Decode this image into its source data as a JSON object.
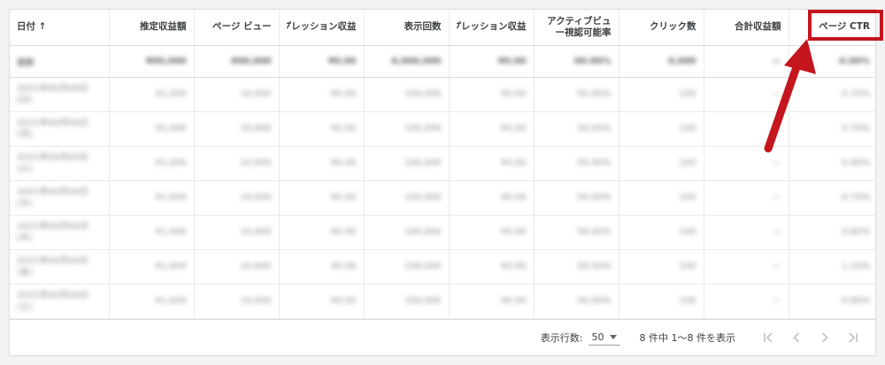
{
  "table": {
    "headers": [
      {
        "label": "日付 ↑",
        "key": "date"
      },
      {
        "label": "推定収益額",
        "key": "est_revenue"
      },
      {
        "label": "ページ ビュー",
        "key": "page_views"
      },
      {
        "label": "ンプレッション収益",
        "key": "impression_rev_1"
      },
      {
        "label": "表示回数",
        "key": "impressions"
      },
      {
        "label": "ンプレッション収益",
        "key": "impression_rev_2"
      },
      {
        "label": "アクティブビュー視認可能率",
        "key": "active_view"
      },
      {
        "label": "クリック数",
        "key": "clicks"
      },
      {
        "label": "合計収益額",
        "key": "total_revenue"
      },
      {
        "label": "ページ CTR",
        "key": "page_ctr"
      }
    ],
    "rows": [
      [
        "合計",
        "¥00,000",
        "000,000",
        "¥0.00",
        "0,000,000",
        "¥0.00",
        "00.00%",
        "0,000",
        "—",
        "0.00%"
      ],
      [
        "2021年00月00日(日)",
        "¥1,000",
        "10,000",
        "¥0.00",
        "100,000",
        "¥0.00",
        "50.00%",
        "100",
        "—",
        "0.70%"
      ],
      [
        "2021年00月00日(月)",
        "¥1,000",
        "10,000",
        "¥0.00",
        "100,000",
        "¥0.00",
        "50.00%",
        "100",
        "—",
        "0.70%"
      ],
      [
        "2021年00月00日(火)",
        "¥1,000",
        "10,000",
        "¥0.00",
        "100,000",
        "¥0.00",
        "50.00%",
        "100",
        "—",
        "0.60%"
      ],
      [
        "2021年00月00日(水)",
        "¥1,000",
        "10,000",
        "¥0.00",
        "100,000",
        "¥0.00",
        "50.00%",
        "100",
        "—",
        "0.70%"
      ],
      [
        "2021年00月00日(木)",
        "¥1,000",
        "10,000",
        "¥0.00",
        "100,000",
        "¥0.00",
        "50.00%",
        "100",
        "—",
        "0.80%"
      ],
      [
        "2021年00月00日(金)",
        "¥1,000",
        "10,000",
        "¥0.00",
        "100,000",
        "¥0.00",
        "50.00%",
        "100",
        "—",
        "1.10%"
      ],
      [
        "2021年00月00日(土)",
        "¥1,000",
        "10,000",
        "¥0.00",
        "100,000",
        "¥0.00",
        "50.00%",
        "100",
        "—",
        "0.80%"
      ]
    ]
  },
  "footer": {
    "rows_per_page_label": "表示行数:",
    "rows_per_page_value": "50",
    "range_text": "8 件中 1〜8 件を表示"
  },
  "colors": {
    "highlight": "#c5151d",
    "border": "#dadce0",
    "pager_disabled": "#bdc1c6"
  },
  "icons": [
    "sort-ascending-icon",
    "first-page-icon",
    "previous-page-icon",
    "next-page-icon",
    "last-page-icon",
    "dropdown-caret-icon",
    "annotation-arrow"
  ]
}
